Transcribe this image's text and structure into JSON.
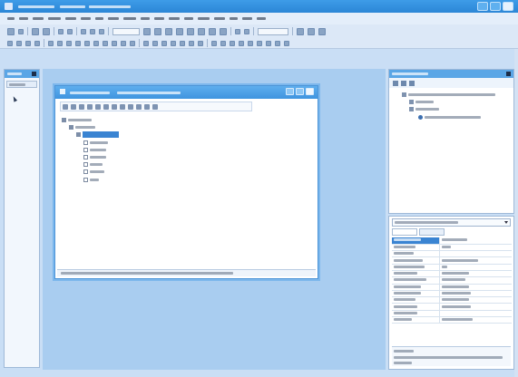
{
  "window": {
    "accent": "#2b86d6",
    "title_visible": false
  },
  "menubar": {
    "items_legible": false,
    "item_count": 18
  },
  "designer": {
    "background": "#a9cdf0",
    "form": {
      "title_legible": false,
      "tree_nodes": [
        {
          "level": 0,
          "kind": "root",
          "selected": false
        },
        {
          "level": 1,
          "kind": "branch",
          "selected": false
        },
        {
          "level": 2,
          "kind": "branch",
          "selected": true
        },
        {
          "level": 3,
          "kind": "checkbox-leaf",
          "selected": false
        },
        {
          "level": 3,
          "kind": "checkbox-leaf",
          "selected": false
        },
        {
          "level": 3,
          "kind": "checkbox-leaf",
          "selected": false
        },
        {
          "level": 3,
          "kind": "checkbox-leaf",
          "selected": false
        },
        {
          "level": 3,
          "kind": "checkbox-leaf",
          "selected": false
        },
        {
          "level": 3,
          "kind": "checkbox-leaf",
          "selected": false
        }
      ]
    }
  },
  "solution_explorer": {
    "row_count": 4
  },
  "properties": {
    "row_count": 13,
    "selected_row": 0
  },
  "icons": [
    "app-icon",
    "pointer-icon",
    "pin-icon",
    "close-icon",
    "globe-icon",
    "checkbox-icon",
    "dropdown-icon"
  ]
}
